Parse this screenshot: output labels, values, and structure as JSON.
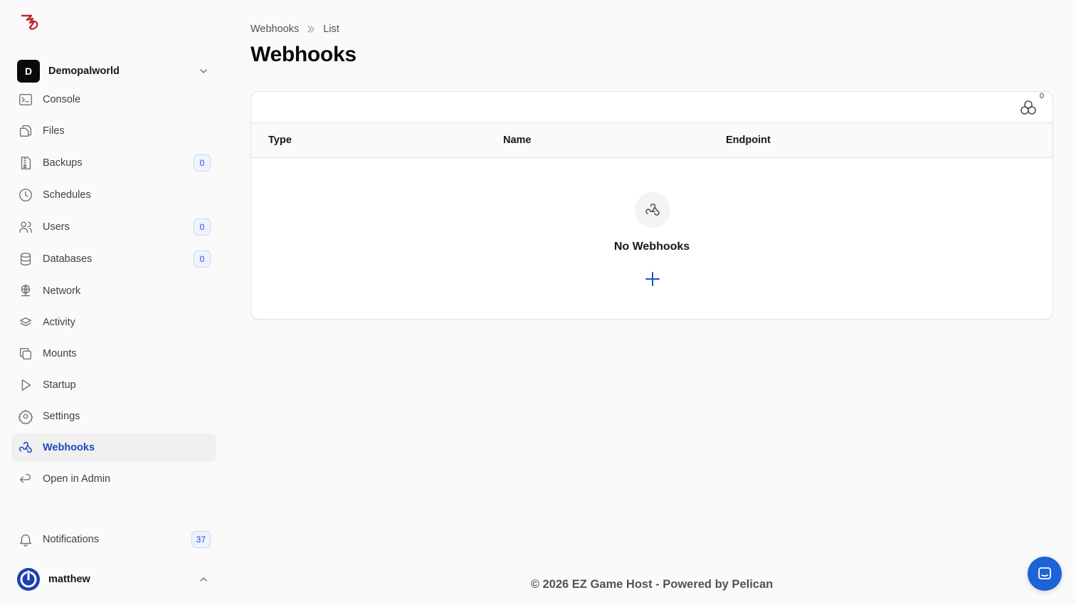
{
  "server": {
    "initial": "D",
    "name": "Demopalworld"
  },
  "nav": [
    {
      "label": "Console",
      "icon": "terminal-icon"
    },
    {
      "label": "Files",
      "icon": "files-icon"
    },
    {
      "label": "Backups",
      "icon": "file-zip-icon",
      "badge": "0"
    },
    {
      "label": "Schedules",
      "icon": "clock-icon"
    },
    {
      "label": "Users",
      "icon": "users-icon",
      "badge": "0"
    },
    {
      "label": "Databases",
      "icon": "database-icon",
      "badge": "0"
    },
    {
      "label": "Network",
      "icon": "network-icon"
    },
    {
      "label": "Activity",
      "icon": "stack-icon"
    },
    {
      "label": "Mounts",
      "icon": "layers-icon"
    },
    {
      "label": "Startup",
      "icon": "play-icon"
    },
    {
      "label": "Settings",
      "icon": "gear-icon"
    },
    {
      "label": "Webhooks",
      "icon": "webhook-icon",
      "active": true
    },
    {
      "label": "Open in Admin",
      "icon": "arrow-back-icon"
    }
  ],
  "notifications": {
    "label": "Notifications",
    "count": "37"
  },
  "user": {
    "name": "matthew"
  },
  "breadcrumb": {
    "parent": "Webhooks",
    "current": "List"
  },
  "page": {
    "title": "Webhooks"
  },
  "table": {
    "column_toggle_count": "0",
    "columns": [
      "Type",
      "Name",
      "Endpoint"
    ],
    "empty_title": "No Webhooks"
  },
  "footer": {
    "text": "© 2026 EZ Game Host - Powered by Pelican"
  },
  "colors": {
    "accent": "#1e4bb8",
    "badge_bg": "#eef3fd",
    "chat": "#1d63d8"
  }
}
